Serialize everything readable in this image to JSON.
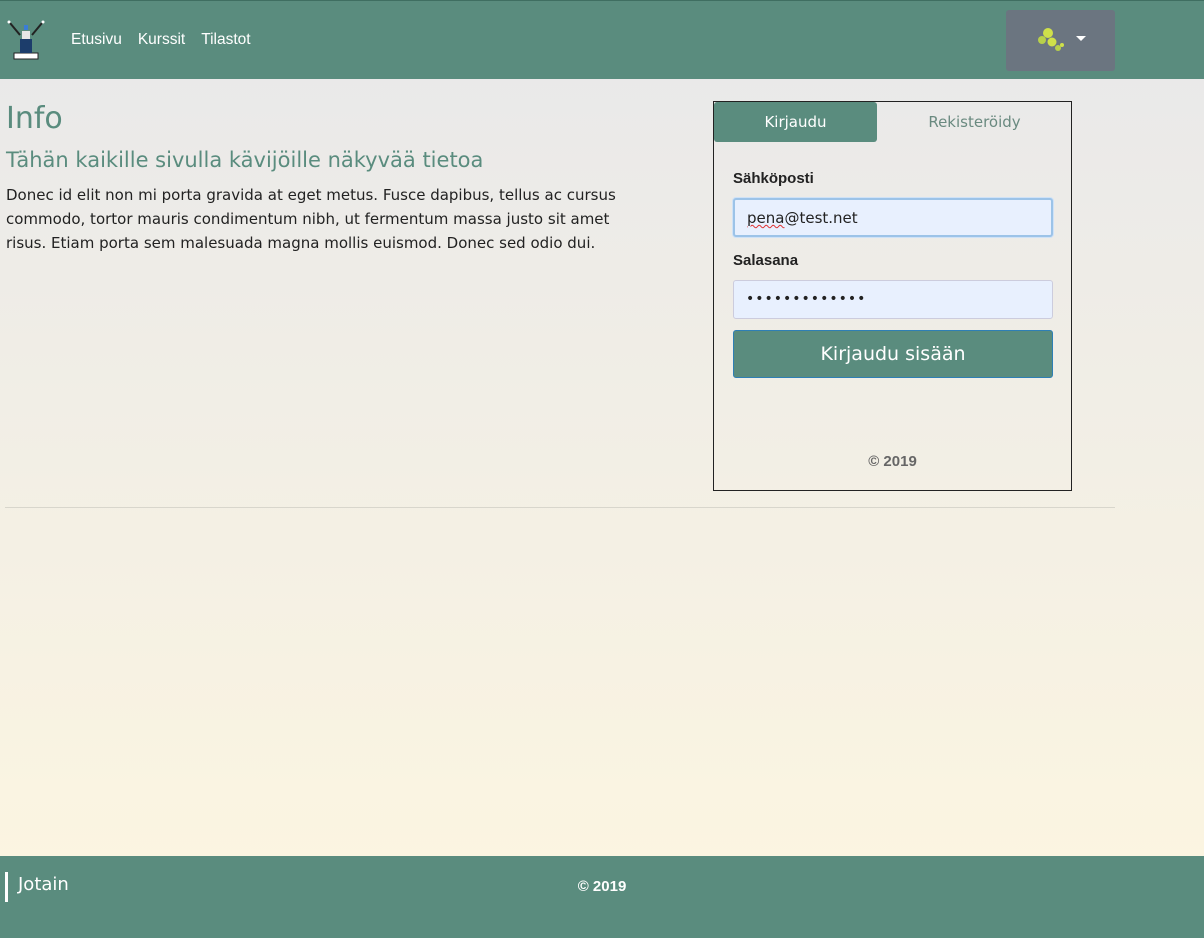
{
  "navbar": {
    "links": [
      "Etusivu",
      "Kurssit",
      "Tilastot"
    ],
    "brand_color": "#5a8c7e",
    "logo_icon": "trophy-figure-icon",
    "user_menu_icon": "user-avatar-icon"
  },
  "info": {
    "title": "Info",
    "subtitle": "Tähän kaikille sivulla kävijöille näkyvää tietoa",
    "body": "Donec id elit non mi porta gravida at eget metus. Fusce dapibus, tellus ac cursus commodo, tortor mauris condimentum nibh, ut fermentum massa justo sit amet risus. Etiam porta sem malesuada magna mollis euismod. Donec sed odio dui."
  },
  "login": {
    "tabs": {
      "login": "Kirjaudu",
      "register": "Rekisteröidy"
    },
    "email_label": "Sähköposti",
    "email_value_prefix": "pena",
    "email_value_suffix": "@test.net",
    "password_label": "Salasana",
    "password_value": "•••••••••••••",
    "submit_label": "Kirjaudu sisään",
    "footer": "© 2019"
  },
  "footer": {
    "left": "Jotain",
    "center": "© 2019"
  }
}
